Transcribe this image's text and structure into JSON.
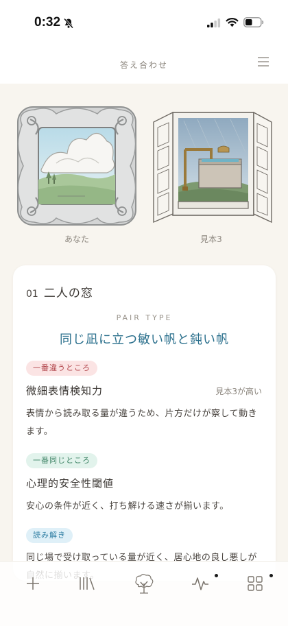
{
  "status_bar": {
    "time": "0:32",
    "icons": [
      "bell-slash-icon",
      "signal-icon",
      "wifi-icon",
      "battery-icon"
    ]
  },
  "header": {
    "title": "答え合わせ",
    "menu_icon": "hamburger-menu-icon"
  },
  "images": {
    "left_label": "あなた",
    "right_label": "見本3"
  },
  "card": {
    "number": "01",
    "title": "二人の窓",
    "pair_type_label": "PAIR TYPE",
    "pair_type_value": "同じ凪に立つ敏い帆と鈍い帆",
    "most_different": {
      "badge": "一番違うところ",
      "title": "微細表情検知力",
      "note": "見本3が高い",
      "body": "表情から読み取る量が違うため、片方だけが察して動きます。"
    },
    "most_same": {
      "badge": "一番同じところ",
      "title": "心理的安全性閾値",
      "body": "安心の条件が近く、打ち解ける速さが揃います。"
    },
    "reading": {
      "badge": "読み解き",
      "body": "同じ場で受け取っている量が近く、居心地の良し悪しが自然に揃います。"
    }
  },
  "bottom_nav": {
    "items": [
      "plus-icon",
      "library-icon",
      "tree-icon",
      "pulse-icon",
      "grid-icon"
    ]
  },
  "colors": {
    "background": "#f8f5ef",
    "accent_blue": "#2a6f8c",
    "badge_red": "#b2474d",
    "badge_green": "#3f8466",
    "badge_blue": "#2f7ea3"
  }
}
